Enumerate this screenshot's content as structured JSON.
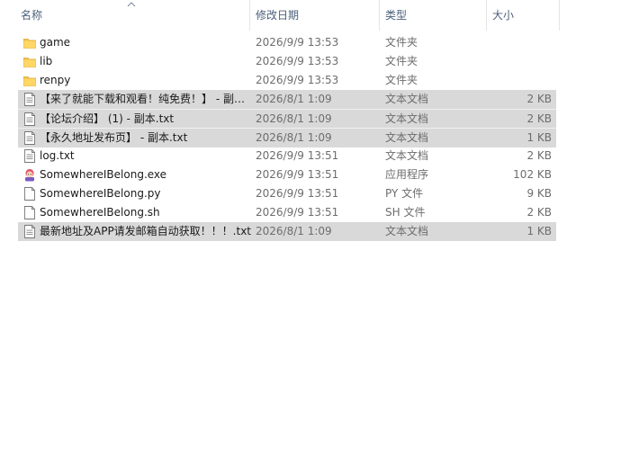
{
  "columns": {
    "name": "名称",
    "date": "修改日期",
    "type": "类型",
    "size": "大小"
  },
  "files": [
    {
      "icon": "folder-icon",
      "name": "game",
      "date": "2026/9/9 13:53",
      "type": "文件夹",
      "size": "",
      "selected": false
    },
    {
      "icon": "folder-icon",
      "name": "lib",
      "date": "2026/9/9 13:53",
      "type": "文件夹",
      "size": "",
      "selected": false
    },
    {
      "icon": "folder-icon",
      "name": "renpy",
      "date": "2026/9/9 13:53",
      "type": "文件夹",
      "size": "",
      "selected": false
    },
    {
      "icon": "text-file-icon",
      "name": "【来了就能下载和观看！纯免费！】 - 副本.txt",
      "date": "2026/8/1 1:09",
      "type": "文本文档",
      "size": "2 KB",
      "selected": true
    },
    {
      "icon": "text-file-icon",
      "name": "【论坛介绍】 (1) - 副本.txt",
      "date": "2026/8/1 1:09",
      "type": "文本文档",
      "size": "2 KB",
      "selected": true
    },
    {
      "icon": "text-file-icon",
      "name": "【永久地址发布页】 - 副本.txt",
      "date": "2026/8/1 1:09",
      "type": "文本文档",
      "size": "1 KB",
      "selected": true
    },
    {
      "icon": "text-file-icon",
      "name": "log.txt",
      "date": "2026/9/9 13:51",
      "type": "文本文档",
      "size": "2 KB",
      "selected": false
    },
    {
      "icon": "app-exe-icon",
      "name": "SomewhereIBelong.exe",
      "date": "2026/9/9 13:51",
      "type": "应用程序",
      "size": "102 KB",
      "selected": false
    },
    {
      "icon": "blank-file-icon",
      "name": "SomewhereIBelong.py",
      "date": "2026/9/9 13:51",
      "type": "PY 文件",
      "size": "9 KB",
      "selected": false
    },
    {
      "icon": "blank-file-icon",
      "name": "SomewhereIBelong.sh",
      "date": "2026/9/9 13:51",
      "type": "SH 文件",
      "size": "2 KB",
      "selected": false
    },
    {
      "icon": "text-file-icon",
      "name": "最新地址及APP请发邮箱自动获取！！！.txt",
      "date": "2026/8/1 1:09",
      "type": "文本文档",
      "size": "1 KB",
      "selected": true
    }
  ]
}
